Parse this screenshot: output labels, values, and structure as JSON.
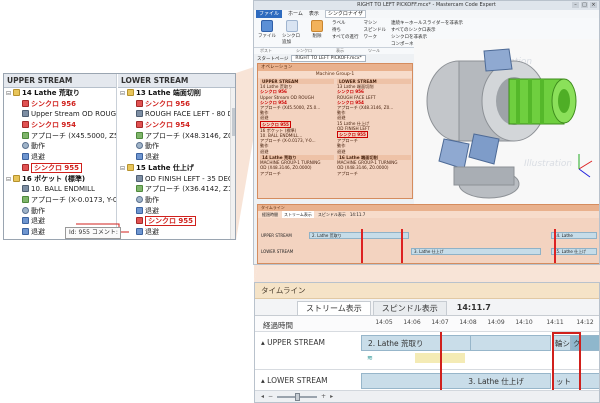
{
  "app": {
    "title": "RIGHT TO LEFT PICKOFF.mcx* - Mastercam Code Expert",
    "menu": [
      "ファイル",
      "ホーム",
      "表示",
      "シンクロナイザ"
    ],
    "ribbon": {
      "buttons": [
        "ファイル",
        "シンクロ追加",
        "削除",
        "すべての進行",
        "スピンドル"
      ],
      "small_items": [
        "ラベル",
        "待ち",
        "マシン",
        "ワーク",
        "連続キーホールスライダーを非表示",
        "すべてのシンクロ表示",
        "シンクロを非表示",
        "コンポーネント"
      ],
      "groups": [
        "ポスト",
        "シンクロ",
        "表示",
        "ツール"
      ]
    },
    "toolbar": {
      "combo_label": "スタートページ",
      "combo_value": "RIGHT TO LEFT PICKOFF.mcx*"
    },
    "opmgr": {
      "header": "オペレーション",
      "group": "Machine Group-1",
      "left_title": "UPPER STREAM",
      "right_title": "LOWER STREAM",
      "left_lines": [
        "14 Lathe 荒取り",
        "シンクロ 956",
        "Upper Stream OD ROUGH",
        "シンクロ 954",
        "アプローチ (X45.5000, Z5.0...",
        "動作",
        "退避",
        "シンクロ 955",
        "16 ポケット (標準)",
        "10. BALL ENDMILL...",
        "アプローチ (X-0.0173, Y-0...",
        "動作",
        "退避"
      ],
      "right_lines": [
        "13 Lathe 端面切削",
        "シンクロ 956",
        "ROUGH FACE LEFT",
        "シンクロ 954",
        "アプローチ (X48.3146, Z0...",
        "動作",
        "退避",
        "15 Lathe 仕上げ",
        "OD FINISH LEFT",
        "シンクロ 955",
        "アプローチ",
        "動作",
        "退避"
      ],
      "bottom_lines": [
        "14 Lathe 荒取り",
        "MACHINE GROUP-1 TURNING",
        "OD (X48.3146, Z0.0000)",
        "アプローチ",
        "16 Lathe 端面切削",
        "MACHINE GROUP-1 TURNING",
        "OD (X48.3146, Z0.0000)",
        "アプローチ"
      ]
    },
    "small_timeline": {
      "header": "タイムライン",
      "tabs": [
        "ストリーム表示",
        "スピンドル表示"
      ],
      "clock": "14:11.7",
      "elapsed": "経過時間",
      "lanes": [
        {
          "name": "UPPER STREAM",
          "bars": [
            "2. Lathe 荒取り",
            "14. Lathe"
          ]
        },
        {
          "name": "LOWER STREAM",
          "bars": [
            "3. Lathe 仕上げ",
            "15. Lathe 仕上げ"
          ]
        }
      ]
    },
    "watermark": "Illustration"
  },
  "tree": {
    "upper": {
      "title": "UPPER STREAM",
      "rows": [
        {
          "kind": "folder",
          "text": "14 Lathe 荒取り",
          "style": "bold",
          "indent": 0
        },
        {
          "kind": "red",
          "text": "シンクロ 956",
          "style": "red",
          "indent": 1
        },
        {
          "kind": "tool",
          "text": "Upper Stream OD ROUGH",
          "style": "",
          "indent": 1
        },
        {
          "kind": "red",
          "text": "シンクロ 954",
          "style": "red",
          "indent": 1
        },
        {
          "kind": "arrow",
          "text": "アプローチ (X45.5000, Z5.00",
          "style": "",
          "indent": 1
        },
        {
          "kind": "gear",
          "text": "動作",
          "style": "",
          "indent": 1
        },
        {
          "kind": "blue",
          "text": "退避",
          "style": "",
          "indent": 1
        },
        {
          "kind": "red",
          "text": "シンクロ 955",
          "style": "sel",
          "indent": 1
        },
        {
          "kind": "folder",
          "text": "16 ポケット (標準)",
          "style": "bold",
          "indent": 0
        },
        {
          "kind": "tool",
          "text": "10. BALL ENDMILL",
          "style": "",
          "indent": 1
        },
        {
          "kind": "arrow",
          "text": "アプローチ (X-0.0173, Y-0.0",
          "style": "",
          "indent": 1
        },
        {
          "kind": "gear",
          "text": "動作",
          "style": "",
          "indent": 1
        },
        {
          "kind": "blue",
          "text": "退避",
          "style": "",
          "indent": 1
        },
        {
          "kind": "blue",
          "text": "退避",
          "style": "",
          "indent": 1
        }
      ]
    },
    "lower": {
      "title": "LOWER STREAM",
      "rows": [
        {
          "kind": "folder",
          "text": "13 Lathe 端面切削",
          "style": "bold",
          "indent": 0
        },
        {
          "kind": "red",
          "text": "シンクロ 956",
          "style": "red",
          "indent": 1
        },
        {
          "kind": "tool",
          "text": "ROUGH FACE LEFT - 80 DEG.",
          "style": "",
          "indent": 1
        },
        {
          "kind": "red",
          "text": "シンクロ 954",
          "style": "red",
          "indent": 1
        },
        {
          "kind": "arrow",
          "text": "アプローチ (X48.3146, Z0.0000)",
          "style": "",
          "indent": 1
        },
        {
          "kind": "gear",
          "text": "動作",
          "style": "",
          "indent": 1
        },
        {
          "kind": "blue",
          "text": "退避",
          "style": "",
          "indent": 1
        },
        {
          "kind": "folder",
          "text": "15 Lathe 仕上げ",
          "style": "bold",
          "indent": 0
        },
        {
          "kind": "tool",
          "text": "OD FINISH LEFT - 35 DEG.",
          "style": "",
          "indent": 1
        },
        {
          "kind": "arrow",
          "text": "アプローチ (X36.4142, Z1.414",
          "style": "",
          "indent": 1
        },
        {
          "kind": "gear",
          "text": "動作",
          "style": "",
          "indent": 1
        },
        {
          "kind": "blue",
          "text": "退避",
          "style": "",
          "indent": 1
        },
        {
          "kind": "red",
          "text": "シンクロ 955",
          "style": "sel",
          "indent": 1
        },
        {
          "kind": "blue",
          "text": "退避",
          "style": "",
          "indent": 1
        }
      ]
    },
    "tooltip": "Id: 955 コメント:"
  },
  "timeline": {
    "title": "タイムライン",
    "tabs": [
      "ストリーム表示",
      "スピンドル表示"
    ],
    "clock": "14:11.7",
    "elapsed_label": "経過時間",
    "ticks": [
      "14:05",
      "14:06",
      "14:07",
      "14:08",
      "14:09",
      "14:10",
      "14:11",
      "14:12"
    ],
    "lanes": [
      {
        "name": "UPPER STREAM",
        "bar": "2. Lathe 荒取り",
        "end_bar": "輪シ",
        "end_bar2": "ク"
      },
      {
        "name": "LOWER STREAM",
        "bar": "3. Lathe 仕上げ",
        "end_bar": "ット"
      }
    ]
  },
  "colors": {
    "accent_red": "#d0201c",
    "bar": "#c9dde9",
    "highlight": "#f3d3c0",
    "timeline_header": "#f5e3c7"
  }
}
